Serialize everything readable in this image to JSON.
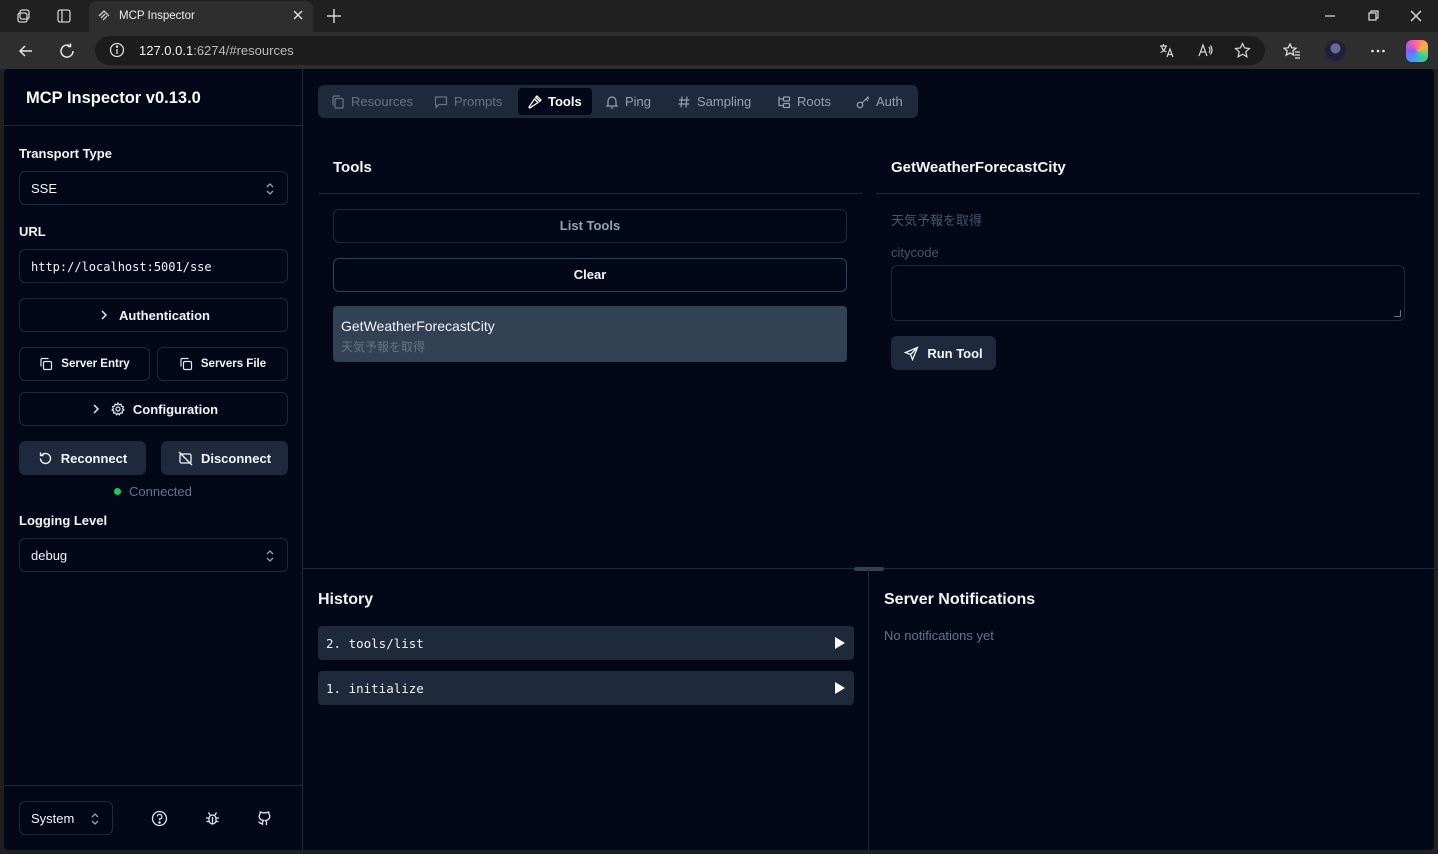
{
  "browser": {
    "tab_title": "MCP Inspector",
    "url_host": "127.0.0.1",
    "url_rest": ":6274/#resources"
  },
  "sidebar": {
    "title": "MCP Inspector v0.13.0",
    "transport_label": "Transport Type",
    "transport_value": "SSE",
    "url_label": "URL",
    "url_value": "http://localhost:5001/sse",
    "authentication": "Authentication",
    "server_entry": "Server Entry",
    "servers_file": "Servers File",
    "configuration": "Configuration",
    "reconnect": "Reconnect",
    "disconnect": "Disconnect",
    "status": "Connected",
    "logging_label": "Logging Level",
    "logging_value": "debug",
    "theme_value": "System"
  },
  "tabs": [
    {
      "label": "Resources"
    },
    {
      "label": "Prompts"
    },
    {
      "label": "Tools"
    },
    {
      "label": "Ping"
    },
    {
      "label": "Sampling"
    },
    {
      "label": "Roots"
    },
    {
      "label": "Auth"
    }
  ],
  "tools_panel": {
    "title": "Tools",
    "list_tools": "List Tools",
    "clear": "Clear",
    "items": [
      {
        "name": "GetWeatherForecastCity",
        "description": "天気予報を取得"
      }
    ]
  },
  "detail_panel": {
    "title": "GetWeatherForecastCity",
    "description": "天気予報を取得",
    "param_label": "citycode",
    "param_value": "",
    "run_tool": "Run Tool"
  },
  "history": {
    "title": "History",
    "items": [
      {
        "label": "2. tools/list"
      },
      {
        "label": "1. initialize"
      }
    ]
  },
  "notifications": {
    "title": "Server Notifications",
    "empty": "No notifications yet"
  },
  "colors": {
    "background": "#020817",
    "border": "#1e293b",
    "connected": "#22c55e"
  }
}
